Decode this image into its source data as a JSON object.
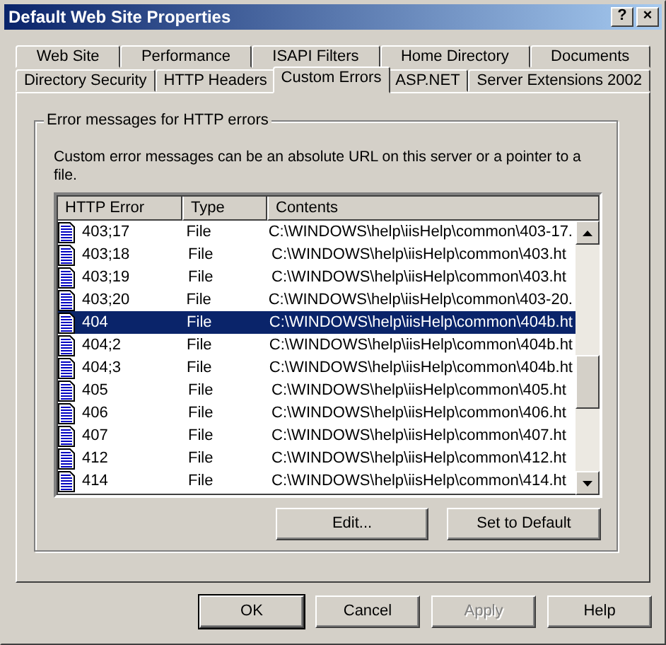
{
  "window": {
    "title": "Default Web Site Properties",
    "title_buttons": [
      "?",
      "×"
    ]
  },
  "tab_rows": [
    [
      {
        "label": "Web Site",
        "selected": false
      },
      {
        "label": "Performance",
        "selected": false
      },
      {
        "label": "ISAPI Filters",
        "selected": false
      },
      {
        "label": "Home Directory",
        "selected": false
      },
      {
        "label": "Documents",
        "selected": false
      }
    ],
    [
      {
        "label": "Directory Security",
        "selected": false
      },
      {
        "label": "HTTP Headers",
        "selected": false
      },
      {
        "label": "Custom Errors",
        "selected": true
      },
      {
        "label": "ASP.NET",
        "selected": false
      },
      {
        "label": "Server Extensions 2002",
        "selected": false
      }
    ]
  ],
  "group": {
    "title": "Error messages for HTTP errors",
    "description": "Custom error messages can be an absolute URL on this server or a pointer to a file."
  },
  "table": {
    "columns": [
      "HTTP Error",
      "Type",
      "Contents"
    ],
    "rows": [
      {
        "error": "403;17",
        "type": "File",
        "contents": "C:\\WINDOWS\\help\\iisHelp\\common\\403-17.",
        "selected": false
      },
      {
        "error": "403;18",
        "type": "File",
        "contents": "C:\\WINDOWS\\help\\iisHelp\\common\\403.ht",
        "selected": false
      },
      {
        "error": "403;19",
        "type": "File",
        "contents": "C:\\WINDOWS\\help\\iisHelp\\common\\403.ht",
        "selected": false
      },
      {
        "error": "403;20",
        "type": "File",
        "contents": "C:\\WINDOWS\\help\\iisHelp\\common\\403-20.",
        "selected": false
      },
      {
        "error": "404",
        "type": "File",
        "contents": "C:\\WINDOWS\\help\\iisHelp\\common\\404b.ht",
        "selected": true
      },
      {
        "error": "404;2",
        "type": "File",
        "contents": "C:\\WINDOWS\\help\\iisHelp\\common\\404b.ht",
        "selected": false
      },
      {
        "error": "404;3",
        "type": "File",
        "contents": "C:\\WINDOWS\\help\\iisHelp\\common\\404b.ht",
        "selected": false
      },
      {
        "error": "405",
        "type": "File",
        "contents": "C:\\WINDOWS\\help\\iisHelp\\common\\405.ht",
        "selected": false
      },
      {
        "error": "406",
        "type": "File",
        "contents": "C:\\WINDOWS\\help\\iisHelp\\common\\406.ht",
        "selected": false
      },
      {
        "error": "407",
        "type": "File",
        "contents": "C:\\WINDOWS\\help\\iisHelp\\common\\407.ht",
        "selected": false
      },
      {
        "error": "412",
        "type": "File",
        "contents": "C:\\WINDOWS\\help\\iisHelp\\common\\412.ht",
        "selected": false
      },
      {
        "error": "414",
        "type": "File",
        "contents": "C:\\WINDOWS\\help\\iisHelp\\common\\414.ht",
        "selected": false
      }
    ]
  },
  "list_buttons": [
    "Edit...",
    "Set to Default"
  ],
  "buttons": [
    {
      "label": "OK",
      "default": true,
      "disabled": false
    },
    {
      "label": "Cancel",
      "default": false,
      "disabled": false
    },
    {
      "label": "Apply",
      "default": false,
      "disabled": true
    },
    {
      "label": "Help",
      "default": false,
      "disabled": false
    }
  ]
}
